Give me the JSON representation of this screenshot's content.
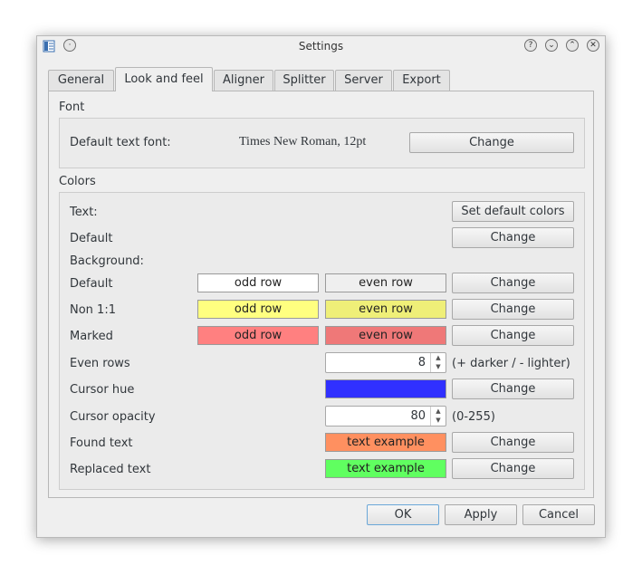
{
  "window": {
    "title": "Settings",
    "controls": {
      "help": "?",
      "minimize": "⌄",
      "maximize": "⌃",
      "close": "✕",
      "menu": "·"
    }
  },
  "tabs": [
    {
      "label": "General"
    },
    {
      "label": "Look and feel"
    },
    {
      "label": "Aligner"
    },
    {
      "label": "Splitter"
    },
    {
      "label": "Server"
    },
    {
      "label": "Export"
    }
  ],
  "font": {
    "section_label": "Font",
    "default_label": "Default text font:",
    "value": "Times New Roman, 12pt",
    "change": "Change"
  },
  "colors": {
    "section_label": "Colors",
    "text_label": "Text:",
    "set_default": "Set default colors",
    "text_default_label": "Default",
    "text_default_change": "Change",
    "background_label": "Background:",
    "rows": [
      {
        "label": "Default",
        "odd": "odd row",
        "even": "even row",
        "odd_color": "#ffffff",
        "even_color": "#efefef",
        "change": "Change"
      },
      {
        "label": "Non 1:1",
        "odd": "odd row",
        "even": "even row",
        "odd_color": "#ffff80",
        "even_color": "#efef78",
        "change": "Change"
      },
      {
        "label": "Marked",
        "odd": "odd row",
        "even": "even row",
        "odd_color": "#ff8080",
        "even_color": "#ef7878",
        "change": "Change"
      }
    ],
    "even_rows": {
      "label": "Even rows",
      "value": "8",
      "hint": "(+ darker / - lighter)"
    },
    "cursor_hue": {
      "label": "Cursor hue",
      "color": "#3030ff",
      "change": "Change"
    },
    "cursor_opacity": {
      "label": "Cursor opacity",
      "value": "80",
      "hint": "(0-255)"
    },
    "found_text": {
      "label": "Found text",
      "sample": "text example",
      "color": "#ff9060",
      "change": "Change"
    },
    "replaced_text": {
      "label": "Replaced text",
      "sample": "text example",
      "color": "#60ff60",
      "change": "Change"
    }
  },
  "buttons": {
    "ok": "OK",
    "apply": "Apply",
    "cancel": "Cancel"
  }
}
